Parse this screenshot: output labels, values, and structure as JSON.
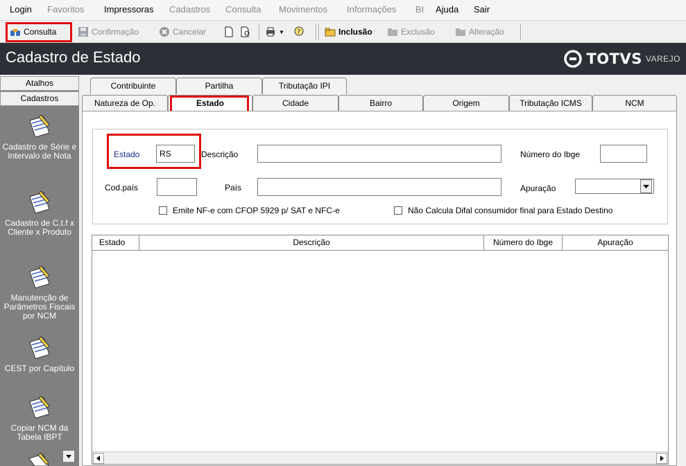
{
  "menubar": {
    "items": [
      {
        "label": "Login",
        "enabled": true
      },
      {
        "label": "Favoritos",
        "enabled": false
      },
      {
        "label": "Impressoras",
        "enabled": true
      },
      {
        "label": "Cadastros",
        "enabled": false
      },
      {
        "label": "Consulta",
        "enabled": false
      },
      {
        "label": "Movimentos",
        "enabled": false
      },
      {
        "label": "Informações",
        "enabled": false
      },
      {
        "label": "BI",
        "enabled": false
      },
      {
        "label": "Ajuda",
        "enabled": true
      },
      {
        "label": "Sair",
        "enabled": true
      }
    ]
  },
  "toolbar": {
    "consulta": "Consulta",
    "confirmacao": "Confirmação",
    "cancelar": "Cancelar",
    "inclusao": "Inclusão",
    "exclusao": "Exclusão",
    "alteracao": "Alteração"
  },
  "header": {
    "title": "Cadastro de Estado",
    "brand": "TOTVS",
    "brand_sub": "VAREJO"
  },
  "sidebar": {
    "tabs": [
      "Atalhos",
      "Cadastros"
    ],
    "items": [
      {
        "label": "Cadastro de Série e Intervalo de Nota"
      },
      {
        "label": "Cadastro de C.t.f x Cliente x Produto"
      },
      {
        "label": "Manutenção de Parâmetros Fiscais por NCM"
      },
      {
        "label": "CEST por Capítulo"
      },
      {
        "label": "Copiar NCM da Tabela IBPT"
      }
    ]
  },
  "tabs": {
    "row1": [
      "Contribuinte",
      "Partilha",
      "Tributação IPI"
    ],
    "row2": [
      "Natureza de Op.",
      "Estado",
      "Cidade",
      "Bairro",
      "Origem",
      "Tributação ICMS",
      "NCM"
    ],
    "active": "Estado"
  },
  "form": {
    "estado_label": "Estado",
    "estado_value": "RS",
    "descricao_label": "Descrição",
    "descricao_value": "",
    "ibge_label": "Número do Ibge",
    "ibge_value": "",
    "codpais_label": "Cod.país",
    "codpais_value": "",
    "pais_label": "País",
    "pais_value": "",
    "apuracao_label": "Apuração",
    "apuracao_value": "",
    "check1_label": "Emite NF-e com CFOP 5929 p/ SAT e NFC-e",
    "check2_label": "Não Calcula Difal consumidor final para Estado Destino"
  },
  "grid": {
    "columns": [
      "Estado",
      "Descrição",
      "Número do Ibge",
      "Apuração"
    ],
    "rows": []
  },
  "colors": {
    "highlight": "#e01010",
    "titlebar": "#2b3037",
    "sidebar": "#808080",
    "estado_label": "#1a2a8c"
  }
}
